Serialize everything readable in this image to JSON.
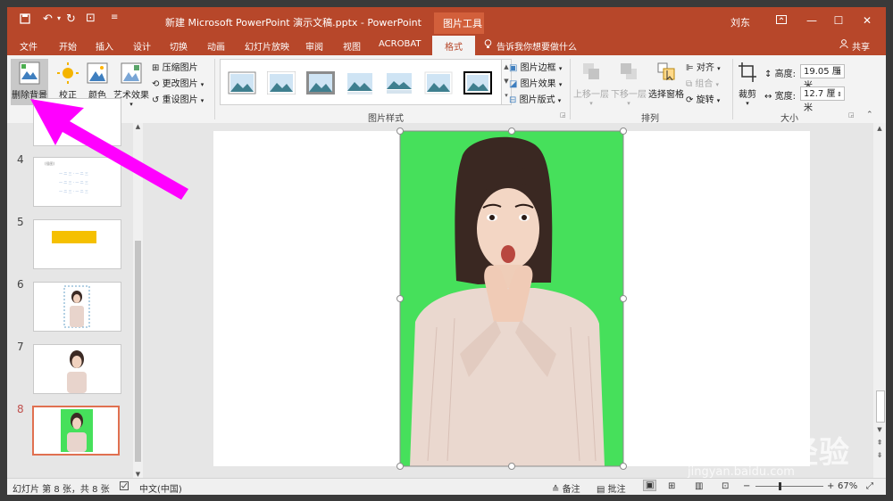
{
  "titlebar": {
    "doc_title": "新建 Microsoft PowerPoint 演示文稿.pptx  -  PowerPoint",
    "context_group": "图片工具",
    "user": "刘东"
  },
  "tabs": [
    "文件",
    "开始",
    "插入",
    "设计",
    "切换",
    "动画",
    "幻灯片放映",
    "审阅",
    "视图",
    "ACROBAT",
    "格式"
  ],
  "tell_me": "告诉我你想要做什么",
  "share": "共享",
  "ribbon": {
    "adjust": {
      "remove_bg": "删除背景",
      "corrections": "校正",
      "color": "颜色",
      "artistic": "艺术效果",
      "compress": "压缩图片",
      "change": "更改图片",
      "reset": "重设图片",
      "label": "调整"
    },
    "styles": {
      "border": "图片边框",
      "effects": "图片效果",
      "layout": "图片版式",
      "label": "图片样式"
    },
    "arrange": {
      "bring_forward": "上移一层",
      "send_backward": "下移一层",
      "selection_pane": "选择窗格",
      "align": "对齐",
      "group": "组合",
      "rotate": "旋转",
      "label": "排列"
    },
    "size": {
      "crop": "裁剪",
      "height_label": "高度:",
      "height_value": "19.05 厘米",
      "width_label": "宽度:",
      "width_value": "12.7 厘米",
      "label": "大小"
    }
  },
  "thumbnails": {
    "visible_numbers": [
      "4",
      "5",
      "6",
      "7",
      "8"
    ],
    "slide4_lines": [
      "(插图)",
      "一 二 三  ·  一 二 三",
      "一 二 三  ·  一 二 三",
      "一 二 三  ·  一 二 三"
    ]
  },
  "status": {
    "slide_info": "幻灯片 第 8 张，共 8 张",
    "language": "中文(中国)",
    "notes": "备注",
    "comments": "批注",
    "zoom": "67%"
  },
  "watermark": {
    "brand": "Baidu经验",
    "url": "jingyan.baidu.com"
  },
  "colors": {
    "accent": "#b7472a",
    "ribbon_bg": "#f3f3f3",
    "picture_green": "#46e05b",
    "annotation_arrow": "#ff00ff"
  }
}
